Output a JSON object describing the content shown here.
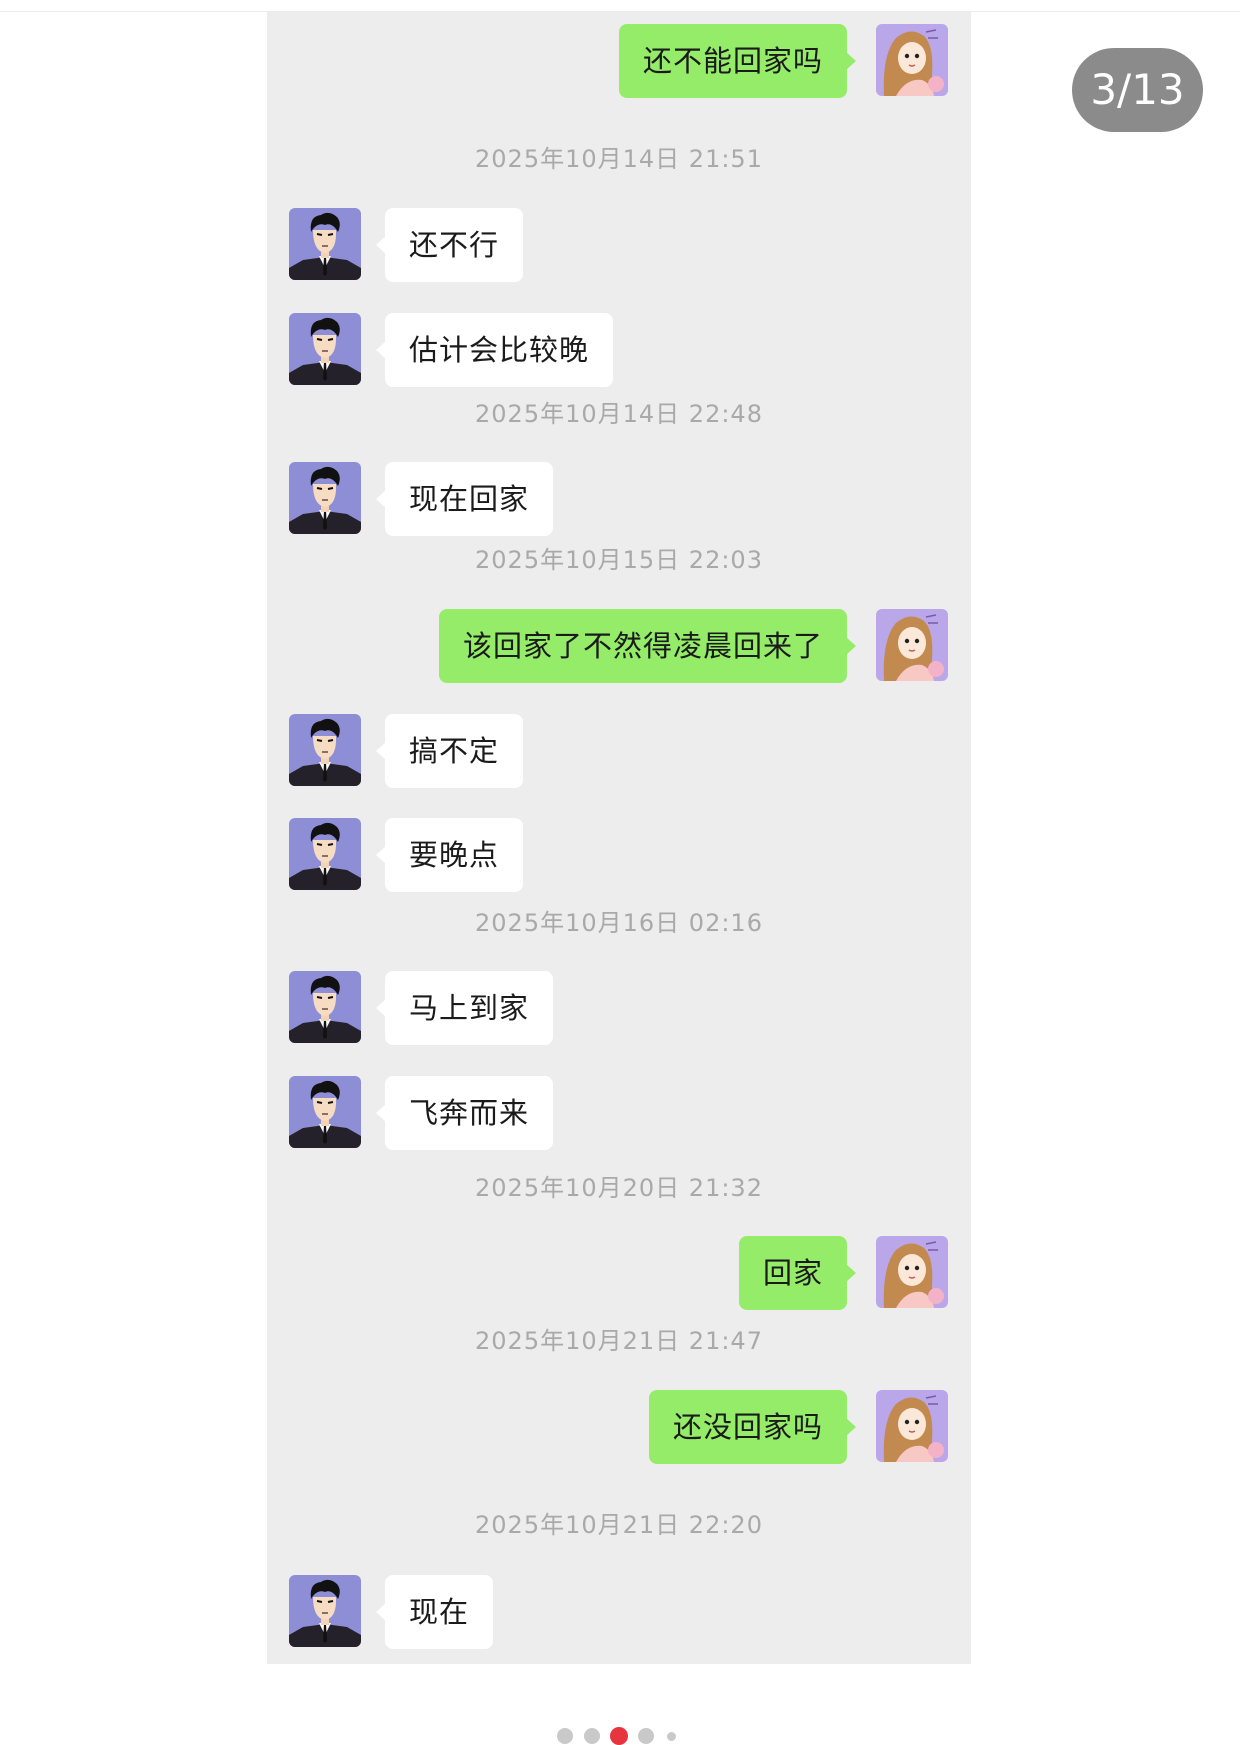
{
  "image_counter": "3/13",
  "timestamps": [
    "2025年10月14日 21:51",
    "2025年10月14日 22:48",
    "2025年10月15日 22:03",
    "2025年10月16日 02:16",
    "2025年10月20日 21:32",
    "2025年10月21日 21:47",
    "2025年10月21日 22:20"
  ],
  "messages": [
    {
      "from": "self",
      "text": "还不能回家吗"
    },
    {
      "from": "other",
      "text": "还不行"
    },
    {
      "from": "other",
      "text": "估计会比较晚"
    },
    {
      "from": "other",
      "text": "现在回家"
    },
    {
      "from": "self",
      "text": "该回家了不然得凌晨回来了"
    },
    {
      "from": "other",
      "text": "搞不定"
    },
    {
      "from": "other",
      "text": "要晚点"
    },
    {
      "from": "other",
      "text": "马上到家"
    },
    {
      "from": "other",
      "text": "飞奔而来"
    },
    {
      "from": "self",
      "text": "回家"
    },
    {
      "from": "self",
      "text": "还没回家吗"
    },
    {
      "from": "other",
      "text": "现在"
    }
  ],
  "avatars": {
    "other": "man-in-suit-avatar",
    "self": "girl-with-long-hair-avatar"
  },
  "pagination": {
    "total_dots": 5,
    "active_index": 2
  },
  "colors": {
    "chat_background": "#ededed",
    "outgoing_bubble": "#95ec69",
    "incoming_bubble": "#ffffff",
    "timestamp_text": "#a9a9a9",
    "counter_background": "#8b8b8b",
    "active_dot": "#e8343f",
    "inactive_dot": "#c9c9c9"
  }
}
